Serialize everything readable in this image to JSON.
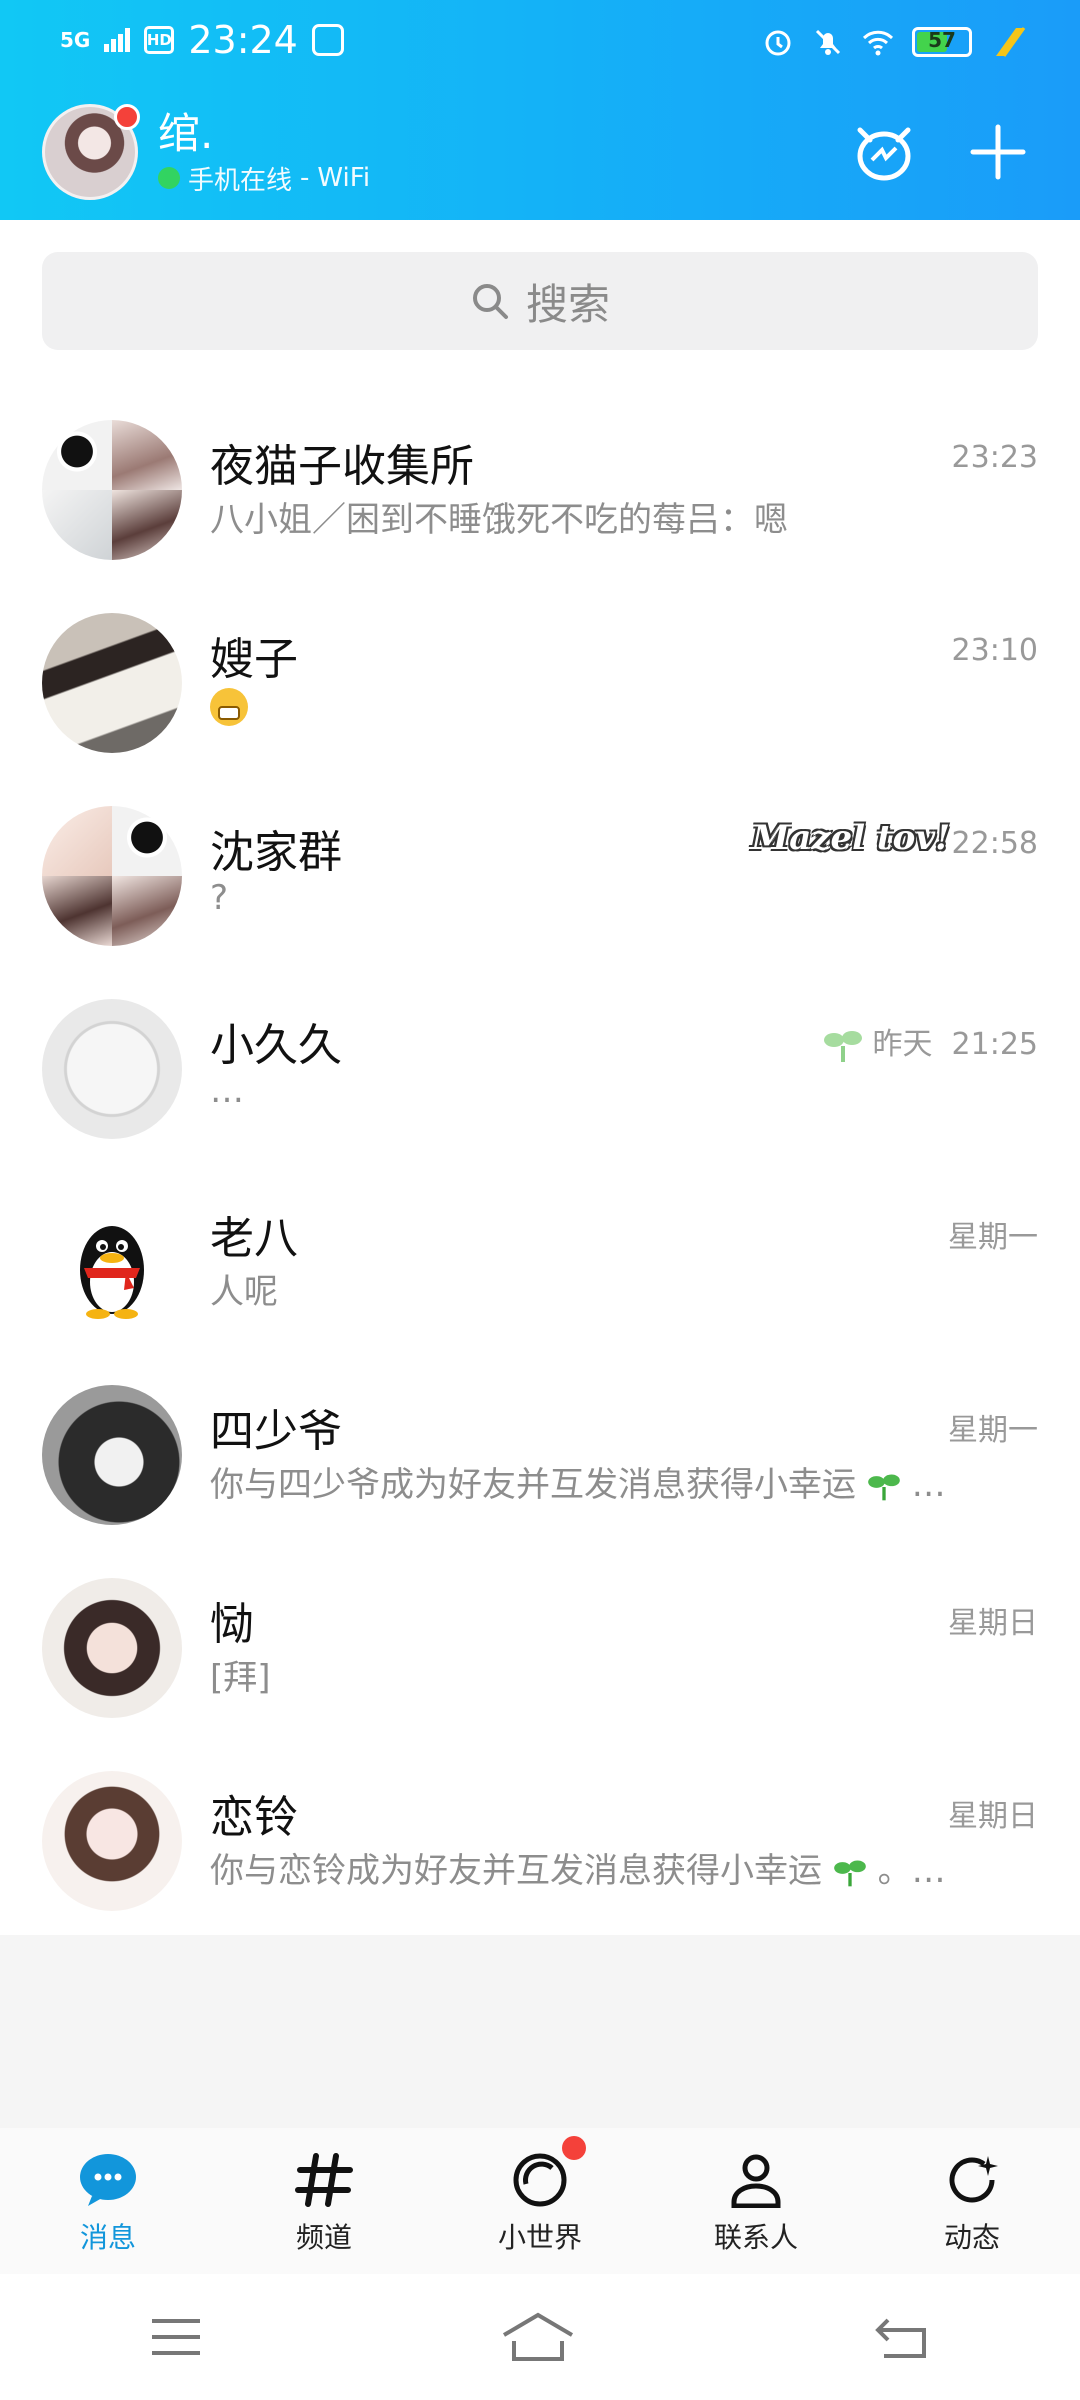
{
  "status_bar": {
    "network": "5G",
    "hd": "HD",
    "time": "23:24",
    "battery": "57",
    "battery_level": 0.57
  },
  "profile": {
    "name": "绾.",
    "online_text": "手机在线",
    "separator": "-",
    "connection": "WiFi"
  },
  "search": {
    "placeholder": "搜索"
  },
  "chats": [
    {
      "name": "夜猫子收集所",
      "message": "八小姐／困到不睡饿死不吃的莓吕：嗯",
      "time": "23:23"
    },
    {
      "name": "嫂子",
      "message": "",
      "emoji": "grinning-face",
      "time": "23:10"
    },
    {
      "name": "沈家群",
      "message": "?",
      "time": "22:58",
      "badge": "Mazel tov!"
    },
    {
      "name": "小久久",
      "message": "…",
      "day": "昨天",
      "time": "21:25"
    },
    {
      "name": "老八",
      "message": "人呢",
      "time": "星期一"
    },
    {
      "name": "四少爷",
      "message": "你与四少爷成为好友并互发消息获得小幸运",
      "suffix": "…",
      "time": "星期一"
    },
    {
      "name": "恸",
      "message": "[拜]",
      "time": "星期日"
    },
    {
      "name": "恋铃",
      "message": "你与恋铃成为好友并互发消息获得小幸运",
      "suffix": "。…",
      "time": "星期日"
    }
  ],
  "tabs": [
    {
      "label": "消息",
      "icon": "chat-bubble-icon",
      "active": true
    },
    {
      "label": "频道",
      "icon": "hashtag-icon",
      "active": false
    },
    {
      "label": "小世界",
      "icon": "planet-icon",
      "active": false
    },
    {
      "label": "联系人",
      "icon": "person-icon",
      "active": false
    },
    {
      "label": "动态",
      "icon": "refresh-star-icon",
      "active": false
    }
  ],
  "colors": {
    "header_start": "#11c8f5",
    "header_end": "#1a9cf9",
    "accent": "#1296db",
    "badge_red": "#f4413a",
    "online_green": "#34d55a"
  }
}
